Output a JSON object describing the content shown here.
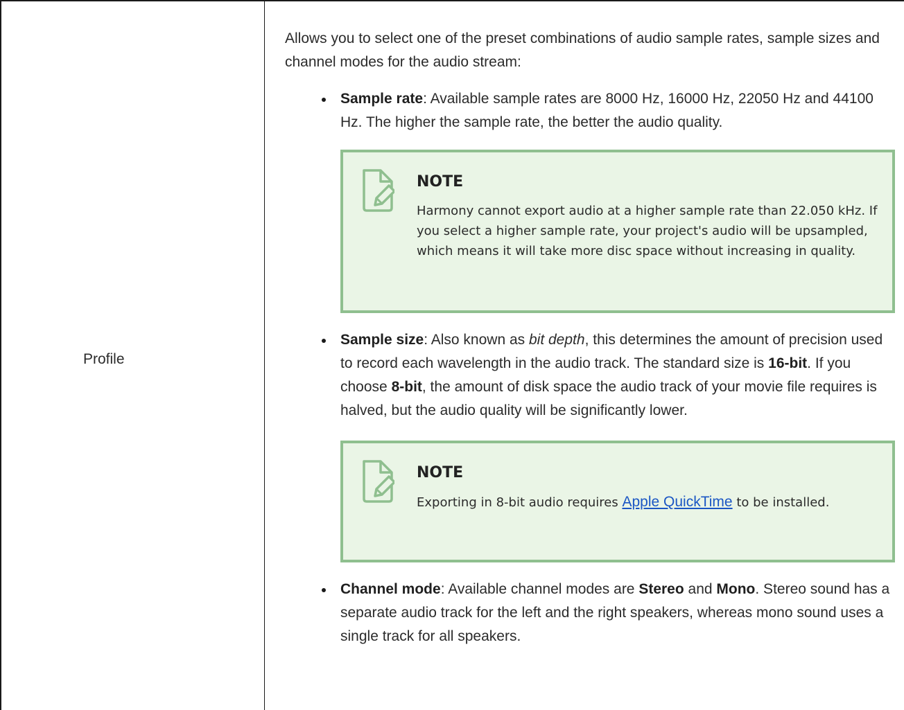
{
  "row_label": "Profile",
  "intro": "Allows you to select one of the preset combinations of audio sample rates, sample sizes and channel modes for the audio stream:",
  "sample_rate": {
    "term": "Sample rate",
    "text": ": Available sample rates are 8000 Hz, 16000 Hz, 22050 Hz and 44100 Hz. The higher the sample rate, the better the audio quality."
  },
  "note1": {
    "title": "NOTE",
    "text": "Harmony cannot export audio at a higher sample rate than 22.050 kHz. If you select a higher sample rate, your project's audio will be upsampled, which means it will take more disc space without increasing in quality."
  },
  "sample_size": {
    "term": "Sample size",
    "text_a": ": Also known as ",
    "italic": "bit depth",
    "text_b": ", this determines the amount of precision used to record each wavelength in the audio track. The standard size is ",
    "bold_16": "16-bit",
    "text_c": ". If you choose ",
    "bold_8": "8-bit",
    "text_d": ", the amount of disk space the audio track of your movie file requires is halved, but the audio quality will be significantly lower."
  },
  "note2": {
    "title": "NOTE",
    "text_before": "Exporting in 8-bit audio requires ",
    "link": "Apple QuickTime",
    "text_after": " to be installed."
  },
  "channel_mode": {
    "term": "Channel mode",
    "text_a": ": Available channel modes are ",
    "bold_stereo": "Stereo",
    "text_b": " and ",
    "bold_mono": "Mono",
    "text_c": ". Stereo sound has a separate audio track for the left and the right speakers, whereas mono sound uses a single track for all speakers."
  },
  "colors": {
    "note_border": "#8fbf8f",
    "note_background": "#eaf5e6",
    "link": "#1a56c4",
    "icon_stroke": "#8fbf8f"
  },
  "icons": {
    "note_icon": "document-pencil-icon"
  }
}
